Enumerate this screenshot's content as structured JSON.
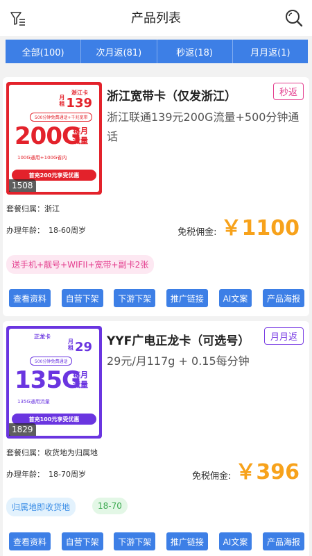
{
  "header": {
    "title": "产品列表"
  },
  "tabs": [
    "全部(100)",
    "次月返(81)",
    "秒返(18)",
    "月月返(1)"
  ],
  "products": [
    {
      "name": "浙江宽带卡（仅发浙江）",
      "tag": "秒返",
      "desc": "浙江联通139元200G流量+500分钟通话",
      "region_label": "套餐归属：",
      "region": "浙江",
      "age_label": "办理年龄：",
      "age": "18-60周岁",
      "commission_label": "免税佣金:",
      "commission": "￥1100",
      "chips": [
        "送手机+靓号+WIFII+宽带+副卡2张"
      ],
      "thumb": {
        "card_name": "浙江卡",
        "price": "139",
        "price_unit": "月租",
        "pill": "500分钟免费通话+千兆宽带",
        "big": "200G",
        "flow": "每月流量",
        "note": "100G通用+100G省内",
        "banner": "首充200元享受优惠",
        "count": "1508"
      },
      "colors": {
        "tag": "#e43f8f",
        "thumb": "#e3222b"
      }
    },
    {
      "name": "YYF广电正龙卡（可选号）",
      "tag": "月月返",
      "desc": "29元/月117g + 0.15每分钟",
      "region_label": "套餐归属：",
      "region": "收货地为归属地",
      "age_label": "办理年龄：",
      "age": "18-70周岁",
      "commission_label": "免税佣金:",
      "commission": "￥396",
      "chips": [
        "归属地即收货地",
        "18-70"
      ],
      "thumb": {
        "card_name": "正龙卡",
        "price": "29",
        "price_unit": "月租",
        "pill": "500分钟免费通话",
        "big": "135G",
        "flow": "每月流量",
        "note": "135G通用流量",
        "banner": "首充100元享受优惠",
        "count": "1829"
      },
      "colors": {
        "tag": "#7b3fe4",
        "thumb": "#6a35e0"
      }
    }
  ],
  "actions": [
    "查看资料",
    "自营下架",
    "下游下架",
    "推广链接",
    "AI文案",
    "产品海报"
  ],
  "colors": {
    "accent": "#3d7fe6",
    "commission": "#f7a21b"
  }
}
